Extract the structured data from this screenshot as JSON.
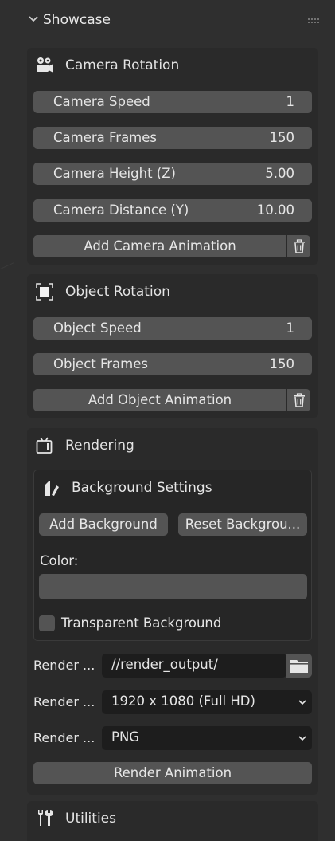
{
  "header": {
    "title": "Showcase"
  },
  "camera_panel": {
    "title": "Camera Rotation",
    "fields": [
      {
        "label": "Camera Speed",
        "value": "1"
      },
      {
        "label": "Camera Frames",
        "value": "150"
      },
      {
        "label": "Camera Height (Z)",
        "value": "5.00"
      },
      {
        "label": "Camera Distance (Y)",
        "value": "10.00"
      }
    ],
    "add_button": "Add Camera Animation"
  },
  "object_panel": {
    "title": "Object Rotation",
    "fields": [
      {
        "label": "Object Speed",
        "value": "1"
      },
      {
        "label": "Object Frames",
        "value": "150"
      }
    ],
    "add_button": "Add Object Animation"
  },
  "rendering_panel": {
    "title": "Rendering",
    "background_settings": {
      "title": "Background Settings",
      "add_button": "Add Background",
      "reset_button": "Reset Backgrou...",
      "color_label": "Color:",
      "transparent_label": "Transparent Background",
      "transparent_checked": false
    },
    "output_path": {
      "label": "Render ...",
      "value": "//render_output/"
    },
    "resolution": {
      "label": "Render ...",
      "value": "1920 x 1080 (Full HD)"
    },
    "format": {
      "label": "Render ...",
      "value": "PNG"
    },
    "render_button": "Render Animation"
  },
  "utilities_panel": {
    "title": "Utilities"
  },
  "colors": {
    "background": "#2f2f2f",
    "panel": "#2a2a2a",
    "field": "#545454",
    "input": "#1d1d1d",
    "text": "#e6e6e6"
  },
  "icons": {
    "header": "chevron-down-icon",
    "grip": "grip-dots-icon",
    "camera": "movie-camera-icon",
    "object": "object-select-icon",
    "rendering": "render-icon",
    "background": "brush-icon",
    "trash": "trash-icon",
    "folder": "folder-icon",
    "utilities": "tools-icon"
  }
}
